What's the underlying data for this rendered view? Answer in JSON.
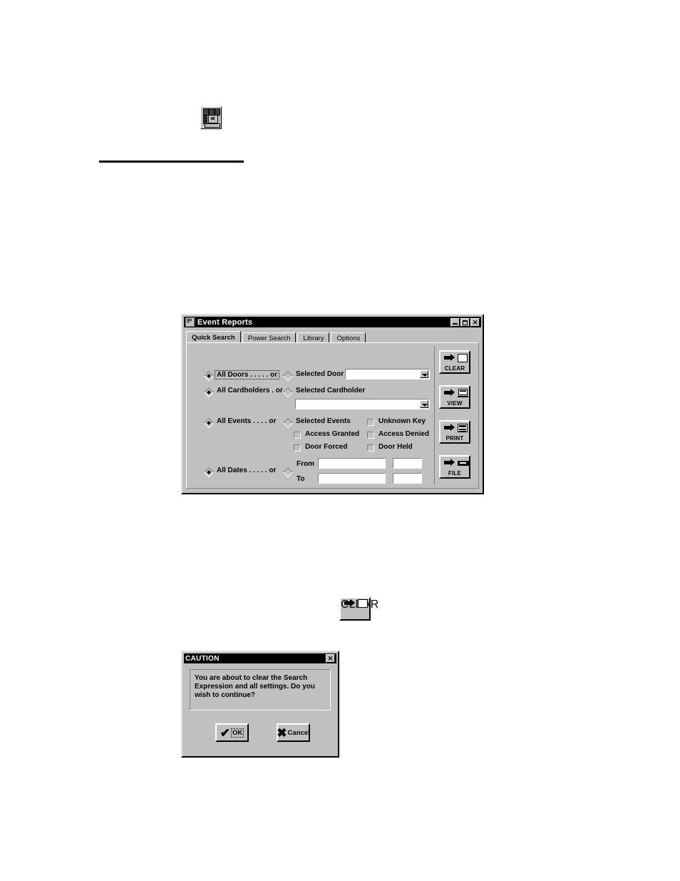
{
  "page": {
    "toolbar_icon": "event-reports-toolbar-icon",
    "divider": "horizontal-rule"
  },
  "event_window": {
    "title": "Event Reports",
    "system_icon": "application-icon",
    "titlebar_buttons": [
      {
        "name": "minimize",
        "label": ""
      },
      {
        "name": "maximize",
        "label": ""
      },
      {
        "name": "close",
        "label": "✕"
      }
    ],
    "tabs": [
      {
        "label": "Quick Search",
        "active": true
      },
      {
        "label": "Power Search",
        "active": false
      },
      {
        "label": "Library",
        "active": false
      },
      {
        "label": "Options",
        "active": false
      }
    ],
    "doors": {
      "all_label": "All Doors . . . . .  or",
      "all_selected": true,
      "selected_label": "Selected Door",
      "selected_checked": false,
      "combo_value": ""
    },
    "cardholders": {
      "all_label": "All Cardholders .  or",
      "all_selected": true,
      "selected_label": "Selected Cardholder",
      "selected_checked": false,
      "combo_value": ""
    },
    "events": {
      "all_label": "All Events . . . .  or",
      "all_selected": true,
      "selected_label": "Selected Events",
      "selected_checked": false,
      "checkboxes": [
        {
          "label": "Unknown Key",
          "checked": false
        },
        {
          "label": "Access Granted",
          "checked": false
        },
        {
          "label": "Access Denied",
          "checked": false
        },
        {
          "label": "Door Forced",
          "checked": false
        },
        {
          "label": "Door Held",
          "checked": false
        }
      ]
    },
    "dates": {
      "all_label": "All Dates . . . . .  or",
      "all_selected": true,
      "range_checked": false,
      "from_label": "From",
      "to_label": "To",
      "from_date": "",
      "from_time": "",
      "to_date": "",
      "to_time": ""
    },
    "actions": [
      {
        "label": "CLEAR",
        "icon": "arrow-to-blank-page-icon"
      },
      {
        "label": "VIEW",
        "icon": "arrow-to-monitor-icon"
      },
      {
        "label": "PRINT",
        "icon": "arrow-to-document-icon"
      },
      {
        "label": "FILE",
        "icon": "arrow-to-disk-icon"
      }
    ]
  },
  "clear_button_figure": {
    "label": "CLEAR",
    "icon": "arrow-to-blank-page-icon"
  },
  "caution_dialog": {
    "title": "CAUTION",
    "close_label": "✕",
    "message": "You are about to clear the Search Expression and all settings.  Do you wish to continue?",
    "ok_label": "OK",
    "ok_glyph": "✔",
    "cancel_label": "Cancel",
    "cancel_glyph": "✖"
  }
}
